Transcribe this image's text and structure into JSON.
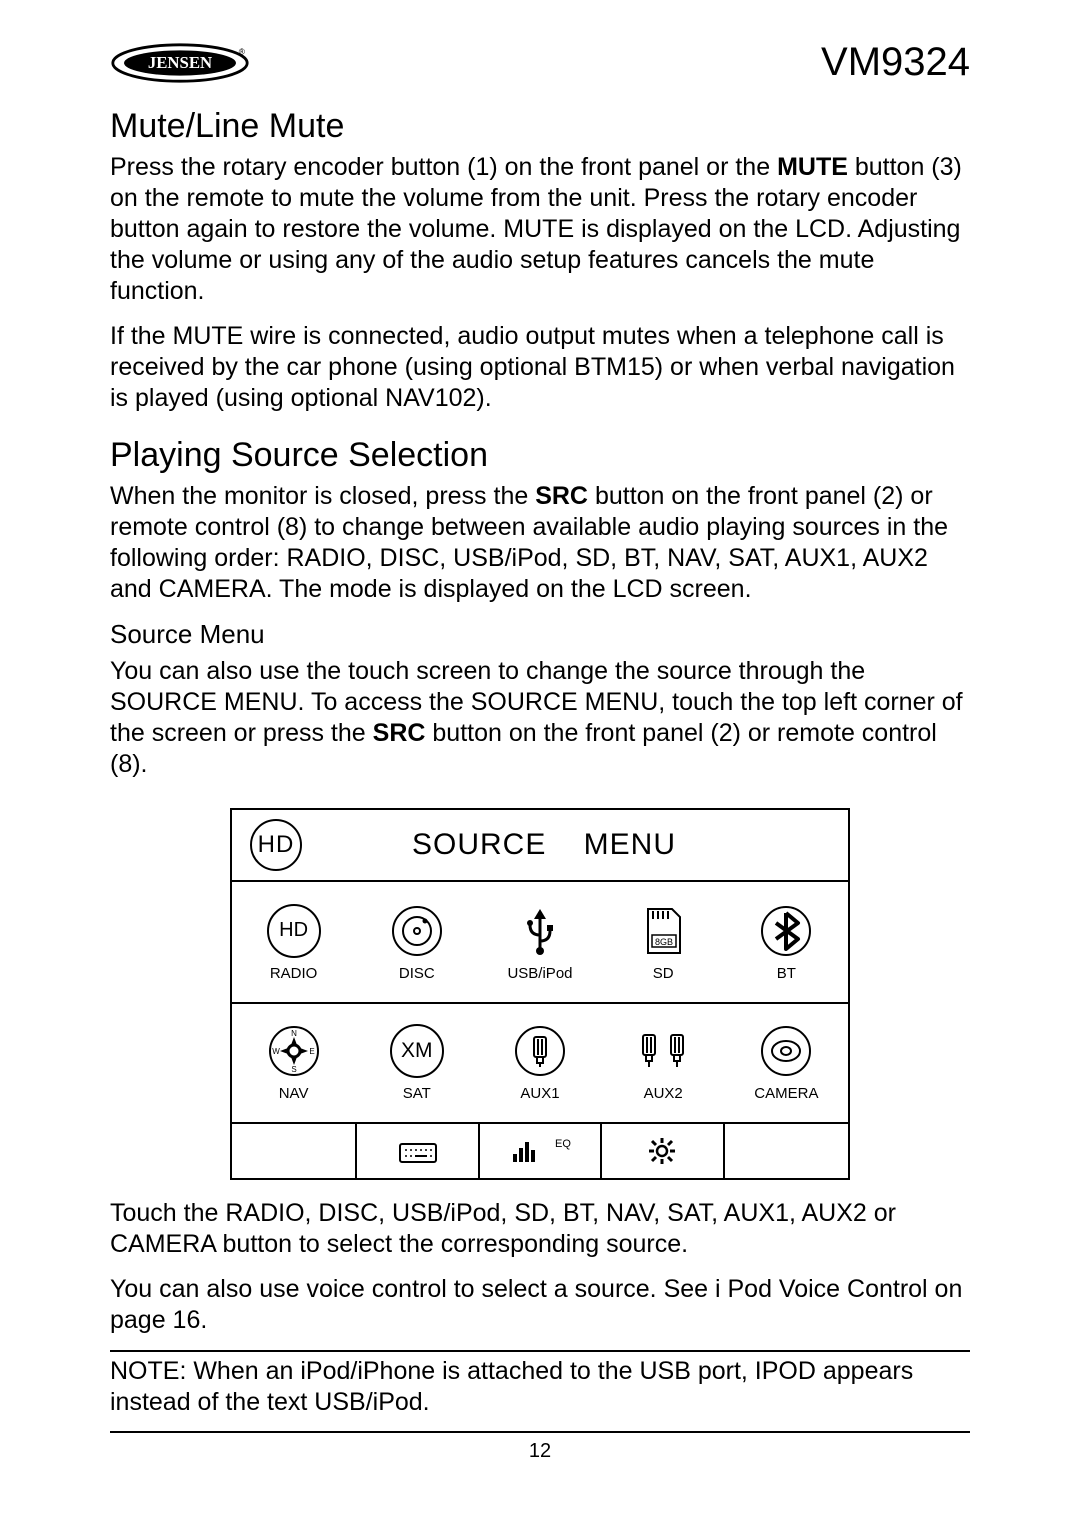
{
  "header": {
    "brand": "JENSEN",
    "model": "VM9324"
  },
  "sections": {
    "mute": {
      "title": "Mute/Line Mute",
      "p1_a": "Press the rotary encoder button (1) on the front panel or the ",
      "p1_bold": "MUTE",
      "p1_b": " button (3) on the remote to mute the volume from the unit. Press the rotary encoder button again to restore the volume.  MUTE  is displayed on the LCD. Adjusting the volume or using any of the audio setup features cancels the mute function.",
      "p2": "If the  MUTE  wire is connected, audio output mutes when a telephone call is received by the car phone (using optional BTM15) or when verbal navigation is played (using optional NAV102)."
    },
    "source": {
      "title": "Playing Source Selection",
      "p1_a": "When the monitor is closed, press the ",
      "p1_bold": "SRC",
      "p1_b": " button on the front panel (2) or remote control (8) to change between available audio playing sources in the following order: RADIO, DISC, USB/iPod, SD, BT, NAV, SAT, AUX1, AUX2 and CAMERA. The mode is displayed on the LCD screen.",
      "sub": "Source Menu",
      "p2_a": "You can also use the touch screen to change the source through the SOURCE MENU. To access the SOURCE MENU, touch the top left corner of the screen or press the ",
      "p2_bold": "SRC",
      "p2_b": " button on the front panel (2) or remote control (8).",
      "p3": "Touch the RADIO, DISC, USB/iPod, SD, BT, NAV, SAT, AUX1, AUX2 or CAMERA button to select the corresponding source.",
      "p4": "You can also use voice control to select a source. See  i Pod   Voice Control on page 16."
    },
    "note": "NOTE: When an iPod/iPhone is attached to the USB port,  IPOD  appears instead of the text  USB/iPod."
  },
  "figure": {
    "corner": "HD",
    "title": "SOURCE MENU",
    "items": [
      {
        "icon": "HD",
        "label": "RADIO"
      },
      {
        "icon": "disc",
        "label": "DISC"
      },
      {
        "icon": "usb",
        "label": "USB/iPod"
      },
      {
        "icon": "sd",
        "label": "SD"
      },
      {
        "icon": "bt",
        "label": "BT"
      },
      {
        "icon": "nav",
        "label": "NAV"
      },
      {
        "icon": "XM",
        "label": "SAT"
      },
      {
        "icon": "aux1",
        "label": "AUX1"
      },
      {
        "icon": "aux2",
        "label": "AUX2"
      },
      {
        "icon": "cam",
        "label": "CAMERA"
      }
    ],
    "footer_eq": "EQ"
  },
  "page_number": "12"
}
